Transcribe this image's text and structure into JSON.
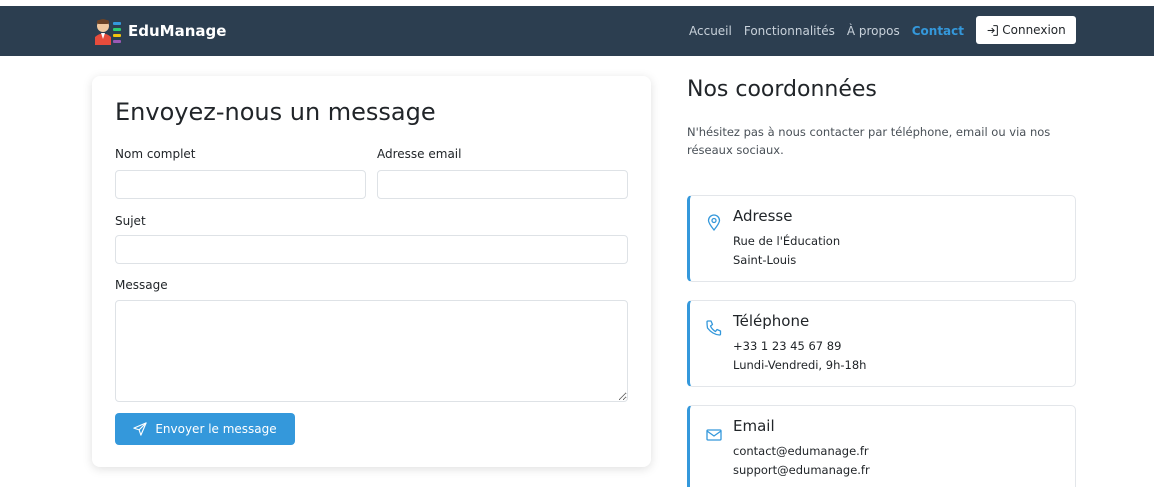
{
  "brand": {
    "name": "EduManage"
  },
  "nav": {
    "links": [
      "Accueil",
      "Fonctionnalités",
      "À propos",
      "Contact"
    ],
    "active": "Contact",
    "login_label": "Connexion"
  },
  "form": {
    "title": "Envoyez-nous un message",
    "name_label": "Nom complet",
    "email_label": "Adresse email",
    "subject_label": "Sujet",
    "message_label": "Message",
    "name_value": "",
    "email_value": "",
    "subject_value": "",
    "message_value": "",
    "submit_label": "Envoyer le message"
  },
  "contact": {
    "title": "Nos coordonnées",
    "intro": "N'hésitez pas à nous contacter par téléphone, email ou via nos réseaux sociaux.",
    "cards": [
      {
        "icon": "location-pin-icon",
        "title": "Adresse",
        "lines": [
          "Rue de l'Éducation",
          "Saint-Louis"
        ]
      },
      {
        "icon": "phone-icon",
        "title": "Téléphone",
        "lines": [
          "+33 1 23 45 67 89",
          "Lundi-Vendredi, 9h-18h"
        ]
      },
      {
        "icon": "envelope-icon",
        "title": "Email",
        "lines": [
          "contact@edumanage.fr",
          "support@edumanage.fr"
        ]
      }
    ]
  },
  "colors": {
    "navbar": "#2c3e50",
    "accent": "#3498db",
    "nav_link": "#c8d1da"
  }
}
